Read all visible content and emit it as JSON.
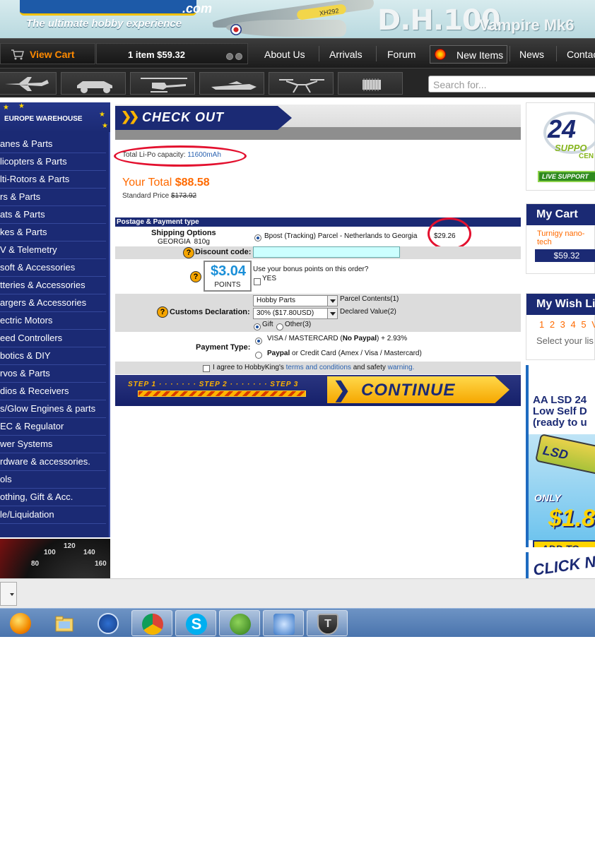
{
  "header": {
    "logo_suffix": ".com",
    "tagline": "The ultimate hobby experience",
    "plane_code": "XH292",
    "model_title": "D.H.100",
    "model_subtitle": "Vampire Mk6"
  },
  "nav": {
    "view_cart": "View Cart",
    "cart_summary": "1 item $59.32",
    "links": [
      "About Us",
      "Arrivals",
      "Forum",
      "New Items",
      "News",
      "Contact"
    ]
  },
  "categories_icons": [
    "airplane-icon",
    "car-icon",
    "helicopter-icon",
    "boat-icon",
    "multirotor-icon",
    "chip-icon"
  ],
  "search": {
    "placeholder": "Search for..."
  },
  "sidebar": {
    "warehouse": "EUROPE WAREHOUSE",
    "items": [
      "anes & Parts",
      "licopters & Parts",
      "lti-Rotors & Parts",
      "rs & Parts",
      "ats & Parts",
      "kes & Parts",
      "V & Telemetry",
      "soft & Accessories",
      "tteries & Accessories",
      "argers & Accessories",
      "ectric Motors",
      "eed Controllers",
      "botics & DIY",
      "rvos & Parts",
      "dios & Receivers",
      "s/Glow Engines & parts",
      "EC & Regulator",
      "wer Systems",
      "rdware & accessories.",
      "ols",
      "othing, Gift & Acc.",
      "le/Liquidation"
    ],
    "speedo_ticks": [
      "80",
      "100",
      "120",
      "140",
      "160"
    ]
  },
  "checkout": {
    "title": "CHECK OUT",
    "lipo_label": "Total Li-Po capacity:",
    "lipo_value": "11600mAh",
    "your_total_label": "Your Total",
    "your_total_value": "$88.58",
    "standard_price_label": "Standard Price",
    "standard_price_value": "$173.92",
    "section_title": "Postage & Payment type",
    "shipping_label": "Shipping Options",
    "shipping_dest": "GEORGIA  810g",
    "shipping_option": "Bpost (Tracking) Parcel - Netherlands to Georgia",
    "shipping_price": "$29.26",
    "discount_label": "Discount code:",
    "discount_value": "",
    "points_amount": "$3.04",
    "points_label": "POINTS",
    "bonus_question": "Use your bonus points on this order?",
    "bonus_yes": "YES",
    "customs_label": "Customs Declaration:",
    "contents_select": "Hobby Parts",
    "contents_label": "Parcel Contents(1)",
    "value_select": "30% ($17.80USD)",
    "value_label": "Declared Value(2)",
    "gift_label": "Gift",
    "other_label": "Other(3)",
    "payment_label": "Payment Type:",
    "payment_visa_pre": "VISA / MASTERCARD (",
    "payment_visa_bold": "No Paypal",
    "payment_visa_post": ") + 2.93%",
    "payment_paypal_bold": "Paypal",
    "payment_paypal_rest": "or Credit Card (Amex / Visa / Mastercard)",
    "agree_pre": "I agree to HobbyKing's",
    "agree_terms": "terms and conditions",
    "agree_mid": "and safety",
    "agree_warning": "warning.",
    "step1": "STEP 1",
    "step2": "STEP 2",
    "step3": "STEP 3",
    "continue": "CONTINUE"
  },
  "right": {
    "support_24": "24",
    "support_word": "SUPPO",
    "support_center": "CEN",
    "live_support": "LIVE SUPPORT",
    "my_cart": "My Cart",
    "cart_item": "Turnigy nano-tech",
    "cart_total": "$59.32",
    "my_wishlist": "My Wish Li",
    "wishlist_pages": "1 2 3 4 5 V",
    "wishlist_select": "Select your lis",
    "promo_title_1": "AA LSD 24",
    "promo_title_2": "Low Self D",
    "promo_title_3": "(ready to u",
    "promo_battery": "LSD",
    "promo_only": "ONLY",
    "promo_price": "$1.8",
    "promo_add": "ADD TO",
    "click_now": "CLICK NOW"
  },
  "colors": {
    "brand_navy": "#1b2a74",
    "accent_orange": "#ff6a00",
    "highlight_red": "#e3102e",
    "link_blue": "#2a62b0"
  }
}
